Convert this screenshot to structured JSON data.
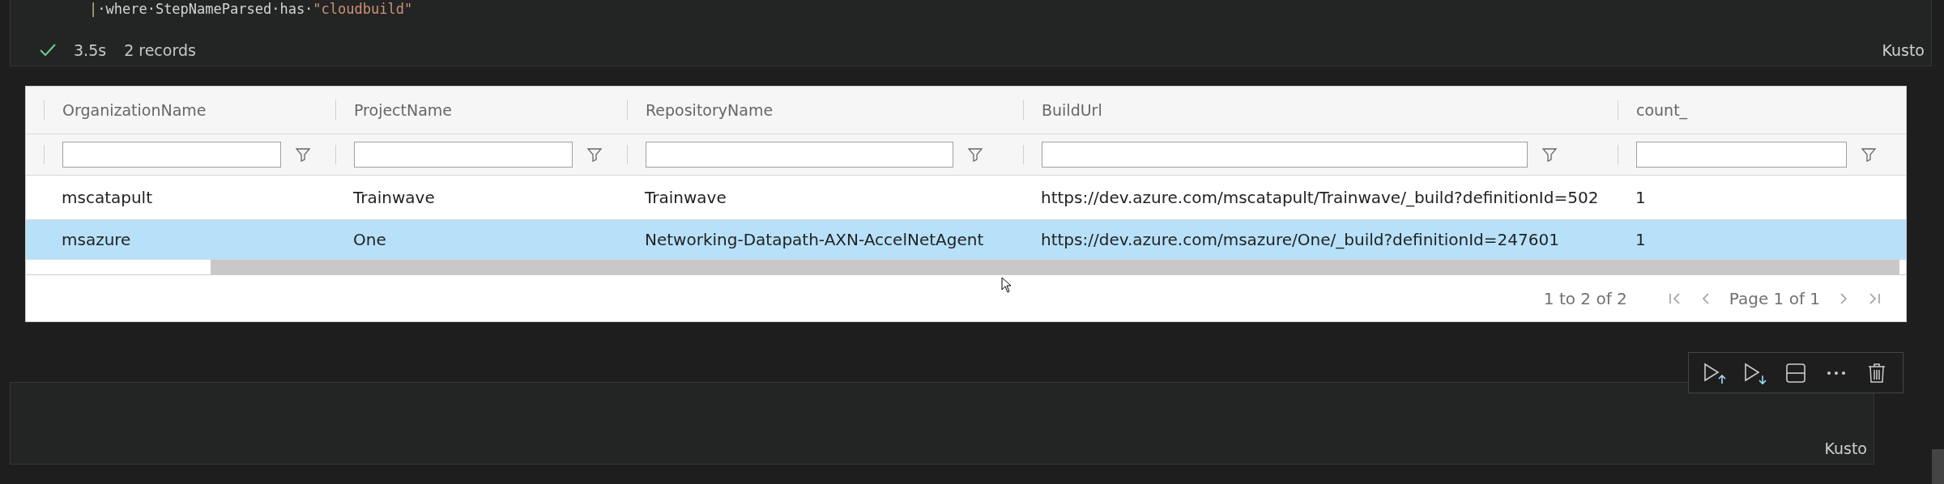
{
  "query_cell": {
    "code_tokens": [
      {
        "text": "|",
        "kind": "operator"
      },
      {
        "text": "·where·StepNameParsed·has·",
        "kind": "plain"
      },
      {
        "text": "\"cloudbuild\"",
        "kind": "string"
      }
    ],
    "status": {
      "succeeded": true,
      "duration": "3.5s",
      "records": "2 records"
    },
    "language": "Kusto"
  },
  "results_table": {
    "columns": [
      "OrganizationName",
      "ProjectName",
      "RepositoryName",
      "BuildUrl",
      "count_"
    ],
    "rows": [
      {
        "selected": false,
        "cells": [
          "mscatapult",
          "Trainwave",
          "Trainwave",
          "https://dev.azure.com/mscatapult/Trainwave/_build?definitionId=502",
          "1"
        ]
      },
      {
        "selected": true,
        "cells": [
          "msazure",
          "One",
          "Networking-Datapath-AXN-AccelNetAgent",
          "https://dev.azure.com/msazure/One/_build?definitionId=247601",
          "1"
        ]
      }
    ],
    "row_summary": "1 to 2 of 2",
    "page_label": "Page 1 of 1"
  },
  "empty_cell": {
    "language": "Kusto"
  }
}
